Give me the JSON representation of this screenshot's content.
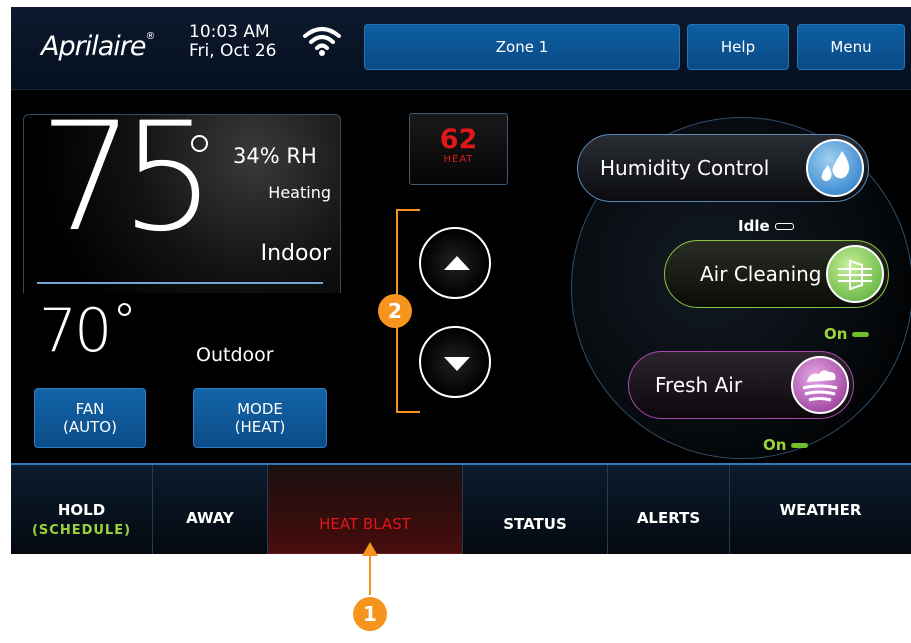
{
  "header": {
    "logo": "Aprilaire",
    "time": "10:03 AM",
    "date": "Fri, Oct 26",
    "zone_label": "Zone 1",
    "help_label": "Help",
    "menu_label": "Menu"
  },
  "indoor": {
    "temperature": "75",
    "humidity": "34% RH",
    "state": "Heating",
    "label": "Indoor"
  },
  "outdoor": {
    "temperature": "70",
    "label": "Outdoor"
  },
  "buttons": {
    "fan_label": "FAN",
    "fan_value": "(AUTO)",
    "mode_label": "MODE",
    "mode_value": "(HEAT)"
  },
  "setpoint": {
    "value": "62",
    "mode": "HEAT"
  },
  "accessories": {
    "humidity": {
      "label": "Humidity Control",
      "status": "Idle"
    },
    "air_cleaning": {
      "label": "Air Cleaning",
      "status": "On"
    },
    "fresh_air": {
      "label": "Fresh Air",
      "status": "On"
    }
  },
  "bottom_tabs": {
    "hold": "HOLD",
    "hold_sub": "(SCHEDULE)",
    "away": "AWAY",
    "heat_blast": "HEAT BLAST",
    "status": "STATUS",
    "alerts": "ALERTS",
    "weather": "WEATHER"
  },
  "callouts": {
    "one": "1",
    "two": "2"
  },
  "colors": {
    "accent_orange": "#f7941d",
    "setpoint_red": "#e01818",
    "button_blue": "#0e5fa2",
    "status_green": "#9bd43a",
    "hold_sub_green": "#9bd43a"
  }
}
